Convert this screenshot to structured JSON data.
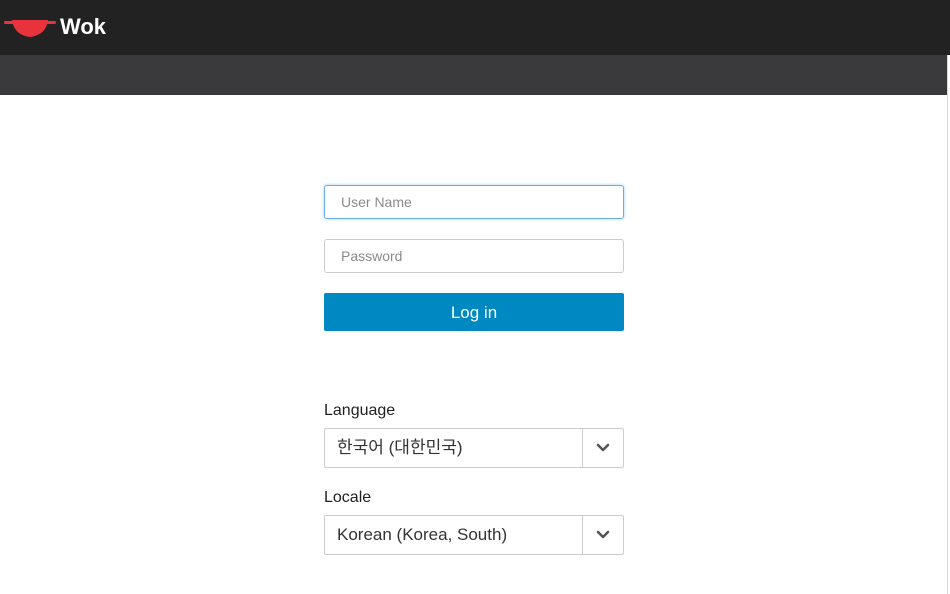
{
  "header": {
    "brand": "Wok",
    "logo_icon": "wok-pan-icon",
    "logo_color": "#e8333c"
  },
  "login": {
    "username_placeholder": "User Name",
    "username_value": "",
    "password_placeholder": "Password",
    "password_value": "",
    "submit_label": "Log in",
    "accent_color": "#0088c2"
  },
  "settings": {
    "language_label": "Language",
    "language_value": "한국어 (대한민국)",
    "locale_label": "Locale",
    "locale_value": "Korean (Korea, South)",
    "dropdown_icon": "chevron-down-icon"
  }
}
